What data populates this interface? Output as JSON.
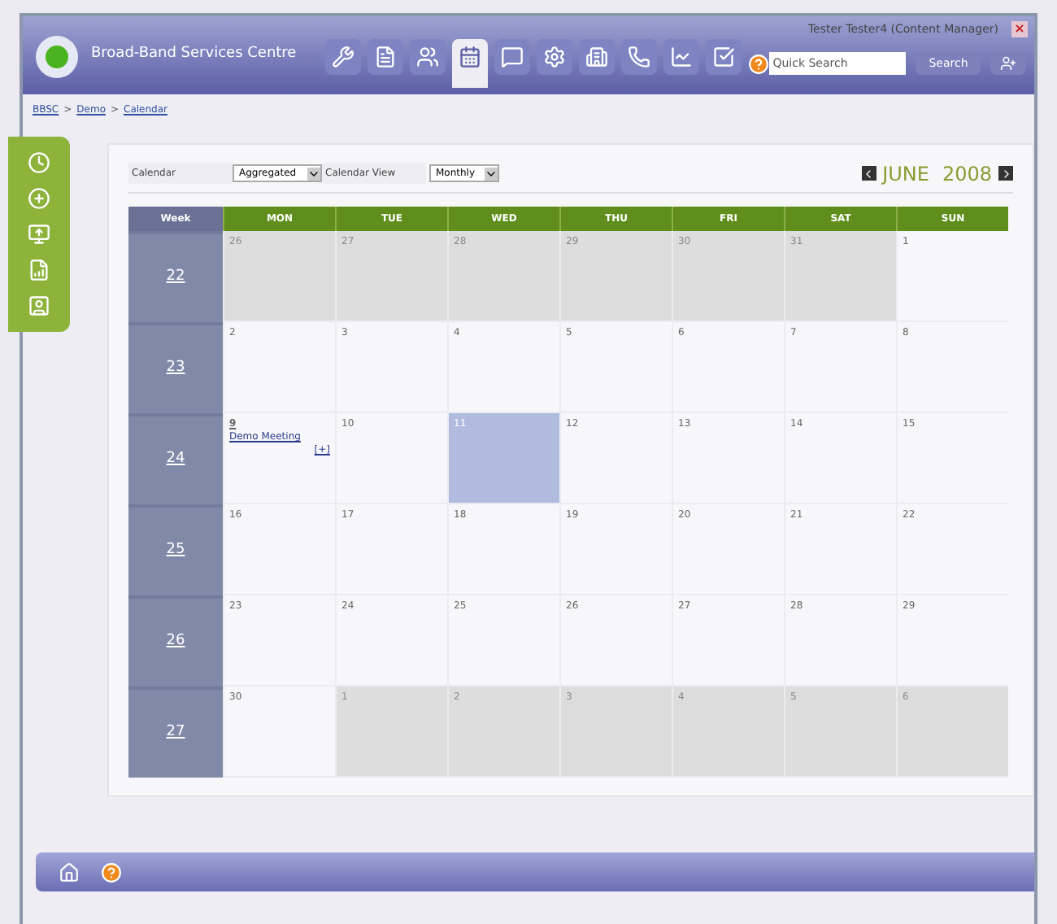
{
  "header": {
    "title": "Broad-Band Services Centre",
    "user": "Tester Tester4 (Content Manager)",
    "close": "×",
    "search": {
      "placeholder": "Quick Search"
    },
    "search_button": "Search"
  },
  "toolbar": [
    {
      "selected": false
    },
    {
      "selected": false
    },
    {
      "selected": false
    },
    {
      "selected": true
    },
    {
      "selected": false
    },
    {
      "selected": false
    },
    {
      "selected": false
    },
    {
      "selected": false
    },
    {
      "selected": false
    },
    {
      "selected": false
    }
  ],
  "breadcrumb": {
    "items": [
      "BBSC",
      "Demo",
      "Calendar"
    ],
    "separator": ">"
  },
  "filters": {
    "calendar_label": "Calendar",
    "calendar_value": "Aggregated",
    "view_label": "Calendar View",
    "view_value": "Monthly"
  },
  "month": "JUNE",
  "year": "2008",
  "columns": [
    "Week",
    "MON",
    "TUE",
    "WED",
    "THU",
    "FRI",
    "SAT",
    "SUN"
  ],
  "weeks": [
    {
      "week": "22",
      "days": [
        {
          "label": "26",
          "in_month": false,
          "selected": false
        },
        {
          "label": "27",
          "in_month": false,
          "selected": false
        },
        {
          "label": "28",
          "in_month": false,
          "selected": false
        },
        {
          "label": "29",
          "in_month": false,
          "selected": false
        },
        {
          "label": "30",
          "in_month": false,
          "selected": false
        },
        {
          "label": "31",
          "in_month": false,
          "selected": false
        },
        {
          "label": "1",
          "in_month": true,
          "selected": false
        }
      ]
    },
    {
      "week": "23",
      "days": [
        {
          "label": "2",
          "in_month": true,
          "selected": false
        },
        {
          "label": "3",
          "in_month": true,
          "selected": false
        },
        {
          "label": "4",
          "in_month": true,
          "selected": false
        },
        {
          "label": "5",
          "in_month": true,
          "selected": false
        },
        {
          "label": "6",
          "in_month": true,
          "selected": false
        },
        {
          "label": "7",
          "in_month": true,
          "selected": false
        },
        {
          "label": "8",
          "in_month": true,
          "selected": false
        }
      ]
    },
    {
      "week": "24",
      "days": [
        {
          "label": "9",
          "in_month": true,
          "selected": false,
          "events": [
            "Demo Meeting"
          ],
          "more": "[+]"
        },
        {
          "label": "10",
          "in_month": true,
          "selected": false
        },
        {
          "label": "11",
          "in_month": true,
          "selected": true
        },
        {
          "label": "12",
          "in_month": true,
          "selected": false
        },
        {
          "label": "13",
          "in_month": true,
          "selected": false
        },
        {
          "label": "14",
          "in_month": true,
          "selected": false
        },
        {
          "label": "15",
          "in_month": true,
          "selected": false
        }
      ]
    },
    {
      "week": "25",
      "days": [
        {
          "label": "16",
          "in_month": true,
          "selected": false
        },
        {
          "label": "17",
          "in_month": true,
          "selected": false
        },
        {
          "label": "18",
          "in_month": true,
          "selected": false
        },
        {
          "label": "19",
          "in_month": true,
          "selected": false
        },
        {
          "label": "20",
          "in_month": true,
          "selected": false
        },
        {
          "label": "21",
          "in_month": true,
          "selected": false
        },
        {
          "label": "22",
          "in_month": true,
          "selected": false
        }
      ]
    },
    {
      "week": "26",
      "days": [
        {
          "label": "23",
          "in_month": true,
          "selected": false
        },
        {
          "label": "24",
          "in_month": true,
          "selected": false
        },
        {
          "label": "25",
          "in_month": true,
          "selected": false
        },
        {
          "label": "26",
          "in_month": true,
          "selected": false
        },
        {
          "label": "27",
          "in_month": true,
          "selected": false
        },
        {
          "label": "28",
          "in_month": true,
          "selected": false
        },
        {
          "label": "29",
          "in_month": true,
          "selected": false
        }
      ]
    },
    {
      "week": "27",
      "days": [
        {
          "label": "30",
          "in_month": true,
          "selected": false
        },
        {
          "label": "1",
          "in_month": false,
          "selected": false
        },
        {
          "label": "2",
          "in_month": false,
          "selected": false
        },
        {
          "label": "3",
          "in_month": false,
          "selected": false
        },
        {
          "label": "4",
          "in_month": false,
          "selected": false
        },
        {
          "label": "5",
          "in_month": false,
          "selected": false
        },
        {
          "label": "6",
          "in_month": false,
          "selected": false
        }
      ]
    }
  ]
}
